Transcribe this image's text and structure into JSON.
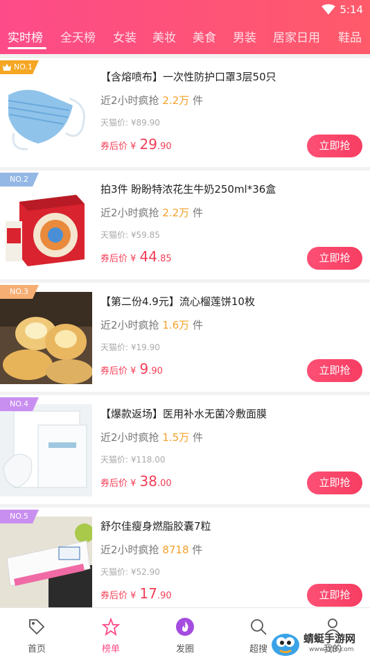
{
  "status_bar": {
    "time": "5:14",
    "wifi_icon": "wifi-icon"
  },
  "tabs": [
    {
      "label": "实时榜",
      "active": true
    },
    {
      "label": "全天榜"
    },
    {
      "label": "女装"
    },
    {
      "label": "美妆"
    },
    {
      "label": "美食"
    },
    {
      "label": "男装"
    },
    {
      "label": "居家日用"
    },
    {
      "label": "鞋品"
    }
  ],
  "colors": {
    "header_start": "#fd4b89",
    "header_end": "#fe5a6a",
    "price": "#f23d56",
    "sales_num": "#f5a02a",
    "button": "#f73d62"
  },
  "products": [
    {
      "rank": "NO.1",
      "title": "【含熔喷布】一次性防护口罩3层50只",
      "sales_prefix": "近2小时疯抢",
      "sales_num": "2.2万",
      "sales_unit": "件",
      "tmall": "天猫价: ¥89.90",
      "price_label": "券后价 ¥",
      "price_int": "29",
      "price_dec": ".90",
      "buy": "立即抢",
      "image": "mask"
    },
    {
      "rank": "NO.2",
      "title": "拍3件 盼盼特浓花生牛奶250ml*36盒",
      "sales_prefix": "近2小时疯抢",
      "sales_num": "2.2万",
      "sales_unit": "件",
      "tmall": "天猫价: ¥59.85",
      "price_label": "券后价 ¥",
      "price_int": "44",
      "price_dec": ".85",
      "buy": "立即抢",
      "image": "milk-box"
    },
    {
      "rank": "NO.3",
      "title": "【第二份4.9元】流心榴莲饼10枚",
      "sales_prefix": "近2小时疯抢",
      "sales_num": "1.6万",
      "sales_unit": "件",
      "tmall": "天猫价: ¥19.90",
      "price_label": "券后价 ¥",
      "price_int": "9",
      "price_dec": ".90",
      "buy": "立即抢",
      "image": "durian-cake"
    },
    {
      "rank": "NO.4",
      "title": "【爆款返场】医用补水无菌冷敷面膜",
      "sales_prefix": "近2小时疯抢",
      "sales_num": "1.5万",
      "sales_unit": "件",
      "tmall": "天猫价: ¥118.00",
      "price_label": "券后价 ¥",
      "price_int": "38",
      "price_dec": ".00",
      "buy": "立即抢",
      "image": "face-mask"
    },
    {
      "rank": "NO.5",
      "title": "舒尔佳瘦身燃脂胶囊7粒",
      "sales_prefix": "近2小时疯抢",
      "sales_num": "8718",
      "sales_unit": "件",
      "tmall": "天猫价: ¥52.90",
      "price_label": "券后价 ¥",
      "price_int": "17",
      "price_dec": ".90",
      "buy": "立即抢",
      "image": "capsule-box"
    }
  ],
  "bottom_nav": [
    {
      "label": "首页",
      "icon": "tag-icon"
    },
    {
      "label": "榜单",
      "icon": "star-icon",
      "active": true
    },
    {
      "label": "发圈",
      "icon": "flame-icon"
    },
    {
      "label": "超搜",
      "icon": "search-icon"
    },
    {
      "label": "我的",
      "icon": "user-icon"
    }
  ],
  "watermark": {
    "text": "蜻蜓手游网",
    "url": "www.QT6.com"
  }
}
